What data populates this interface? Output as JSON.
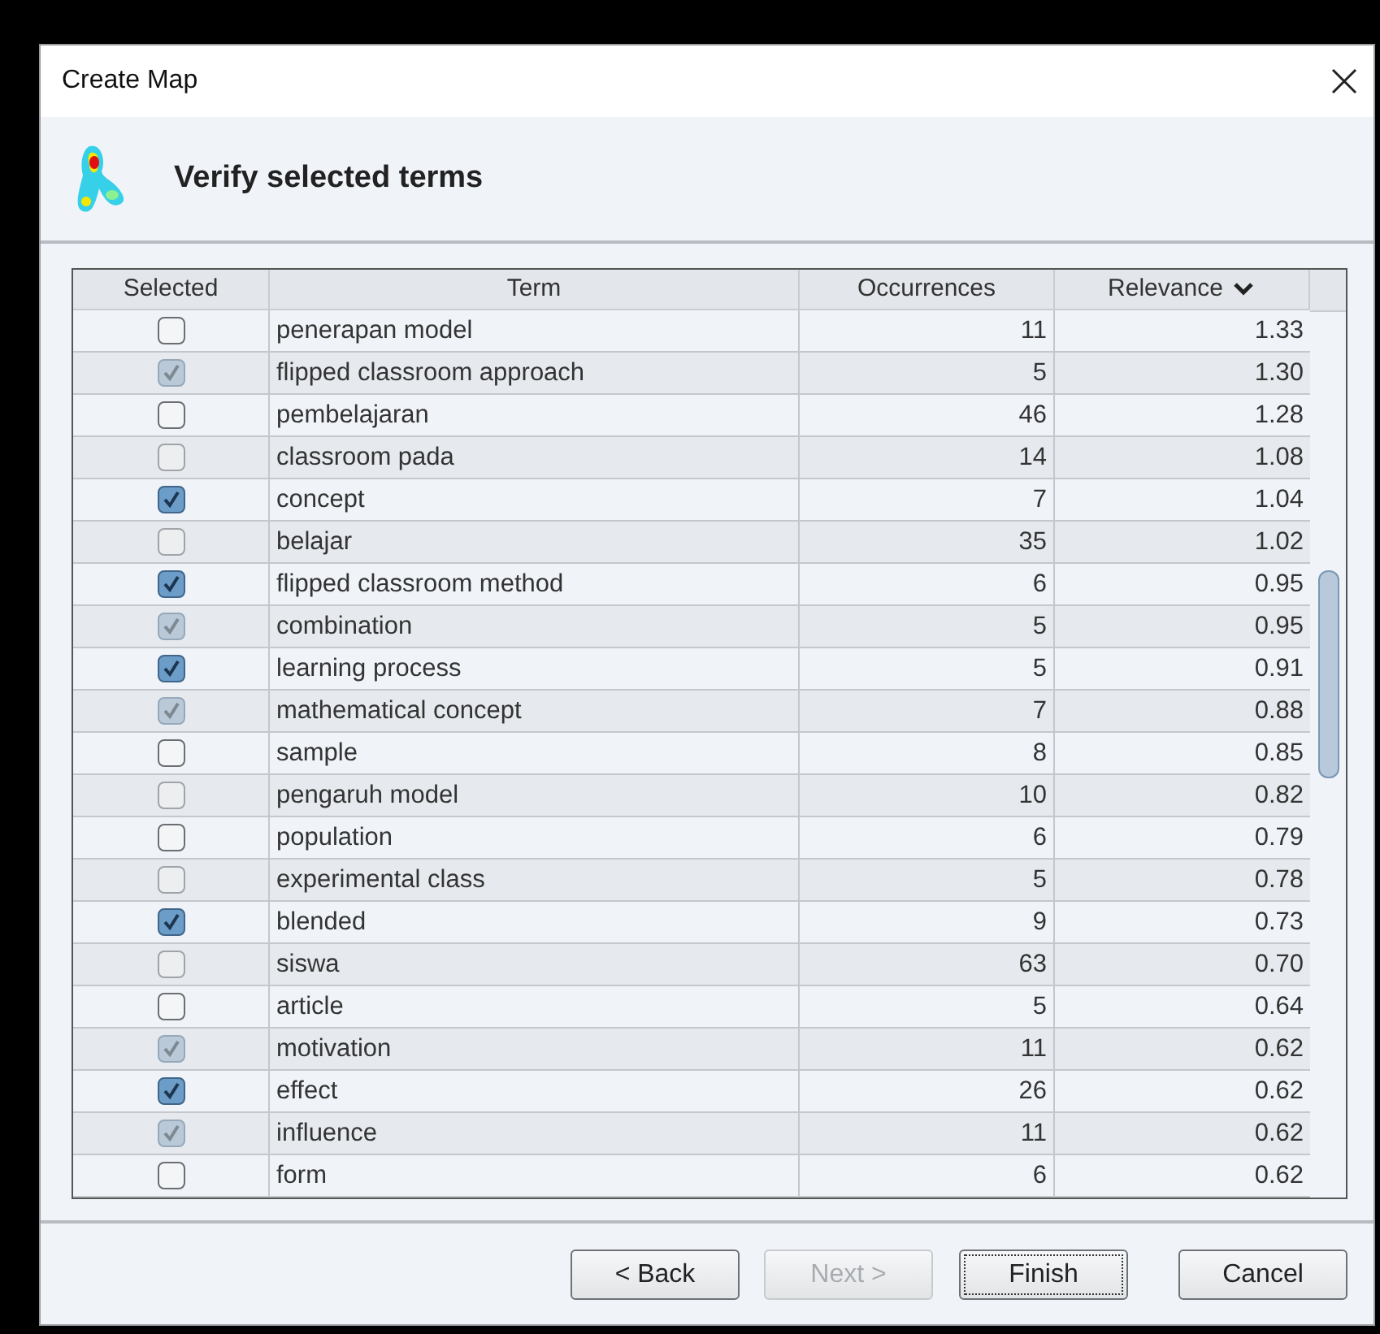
{
  "window": {
    "title": "Create Map"
  },
  "header": {
    "title": "Verify selected terms"
  },
  "table": {
    "columns": [
      {
        "label": "Selected"
      },
      {
        "label": "Term"
      },
      {
        "label": "Occurrences"
      },
      {
        "label": "Relevance",
        "sorted": true
      }
    ],
    "rows": [
      {
        "checked": false,
        "term": "penerapan model",
        "occurrences": "11",
        "relevance": "1.33"
      },
      {
        "checked": true,
        "term": "flipped classroom approach",
        "occurrences": "5",
        "relevance": "1.30"
      },
      {
        "checked": false,
        "term": "pembelajaran",
        "occurrences": "46",
        "relevance": "1.28"
      },
      {
        "checked": false,
        "term": "classroom pada",
        "occurrences": "14",
        "relevance": "1.08"
      },
      {
        "checked": true,
        "term": "concept",
        "occurrences": "7",
        "relevance": "1.04"
      },
      {
        "checked": false,
        "term": "belajar",
        "occurrences": "35",
        "relevance": "1.02"
      },
      {
        "checked": true,
        "term": "flipped classroom method",
        "occurrences": "6",
        "relevance": "0.95"
      },
      {
        "checked": true,
        "term": "combination",
        "occurrences": "5",
        "relevance": "0.95"
      },
      {
        "checked": true,
        "term": "learning process",
        "occurrences": "5",
        "relevance": "0.91"
      },
      {
        "checked": true,
        "term": "mathematical concept",
        "occurrences": "7",
        "relevance": "0.88"
      },
      {
        "checked": false,
        "term": "sample",
        "occurrences": "8",
        "relevance": "0.85"
      },
      {
        "checked": false,
        "term": "pengaruh model",
        "occurrences": "10",
        "relevance": "0.82"
      },
      {
        "checked": false,
        "term": "population",
        "occurrences": "6",
        "relevance": "0.79"
      },
      {
        "checked": false,
        "term": "experimental class",
        "occurrences": "5",
        "relevance": "0.78"
      },
      {
        "checked": true,
        "term": "blended",
        "occurrences": "9",
        "relevance": "0.73"
      },
      {
        "checked": false,
        "term": "siswa",
        "occurrences": "63",
        "relevance": "0.70"
      },
      {
        "checked": false,
        "term": "article",
        "occurrences": "5",
        "relevance": "0.64"
      },
      {
        "checked": true,
        "term": "motivation",
        "occurrences": "11",
        "relevance": "0.62"
      },
      {
        "checked": true,
        "term": "effect",
        "occurrences": "26",
        "relevance": "0.62"
      },
      {
        "checked": true,
        "term": "influence",
        "occurrences": "11",
        "relevance": "0.62"
      },
      {
        "checked": false,
        "term": "form",
        "occurrences": "6",
        "relevance": "0.62"
      }
    ]
  },
  "buttons": [
    {
      "label": "< Back",
      "disabled": false,
      "focused": false
    },
    {
      "label": "Next >",
      "disabled": true,
      "focused": false
    },
    {
      "label": "Finish",
      "disabled": false,
      "focused": true
    },
    {
      "label": "Cancel",
      "disabled": false,
      "focused": false
    }
  ]
}
